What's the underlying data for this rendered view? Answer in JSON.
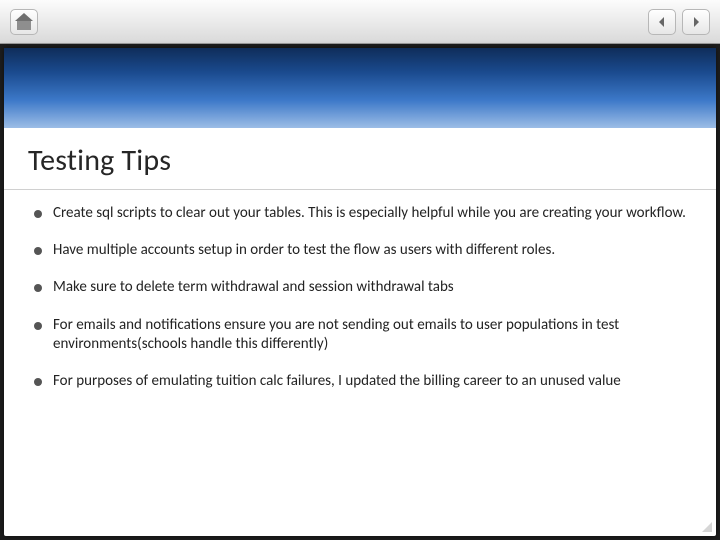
{
  "slide": {
    "title": "Testing Tips",
    "bullets": [
      "Create sql scripts to clear out your tables.  This is especially helpful while you are creating your workflow.",
      "Have multiple accounts setup in order to test the flow as users with different roles.",
      "Make sure to delete term withdrawal and session withdrawal tabs",
      "For emails and notifications ensure you are not sending out emails to user populations in test environments(schools handle this differently)",
      "For purposes of emulating tuition calc failures, I updated the billing career to an unused value"
    ]
  }
}
